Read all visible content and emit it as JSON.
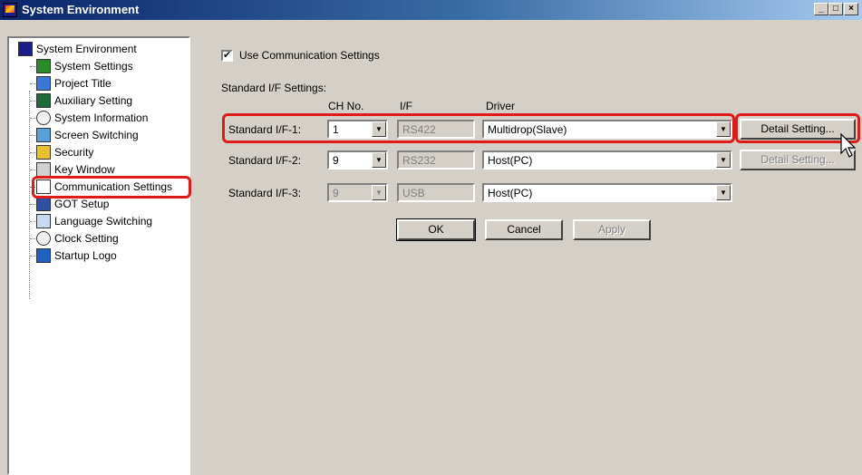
{
  "window": {
    "title": "System Environment",
    "controls": [
      "_",
      "□",
      "×"
    ]
  },
  "tree": {
    "root": "System Environment",
    "items": [
      {
        "label": "System Settings",
        "icon": "system-settings-icon"
      },
      {
        "label": "Project Title",
        "icon": "project-title-icon"
      },
      {
        "label": "Auxiliary Setting",
        "icon": "auxiliary-setting-icon"
      },
      {
        "label": "System Information",
        "icon": "system-information-icon"
      },
      {
        "label": "Screen Switching",
        "icon": "screen-switching-icon"
      },
      {
        "label": "Security",
        "icon": "security-icon"
      },
      {
        "label": "Key Window",
        "icon": "key-window-icon"
      },
      {
        "label": "Communication Settings",
        "icon": "communication-settings-icon",
        "selected": true
      },
      {
        "label": "GOT Setup",
        "icon": "got-setup-icon"
      },
      {
        "label": "Language Switching",
        "icon": "language-switching-icon"
      },
      {
        "label": "Clock Setting",
        "icon": "clock-icon"
      },
      {
        "label": "Startup Logo",
        "icon": "startup-logo-icon"
      }
    ]
  },
  "use_comm": {
    "checked": true,
    "label": "Use Communication Settings"
  },
  "standard": {
    "section_label": "Standard I/F Settings:",
    "col_ch": "CH No.",
    "col_if": "I/F",
    "col_driver": "Driver",
    "rows": [
      {
        "label": "Standard I/F-1:",
        "ch": "1",
        "if": "RS422",
        "driver": "Multidrop(Slave)",
        "detail": "Detail Setting...",
        "detail_enabled": true
      },
      {
        "label": "Standard I/F-2:",
        "ch": "9",
        "if": "RS232",
        "driver": "Host(PC)",
        "detail": "Detail Setting...",
        "detail_enabled": false
      },
      {
        "label": "Standard I/F-3:",
        "ch": "9",
        "if": "USB",
        "driver": "Host(PC)",
        "detail": "",
        "detail_enabled": false
      }
    ]
  },
  "buttons": {
    "ok": "OK",
    "cancel": "Cancel",
    "apply": "Apply"
  },
  "colors": {
    "highlight": "#e01919",
    "face": "#d4d0c8",
    "title_start": "#0a246a"
  }
}
